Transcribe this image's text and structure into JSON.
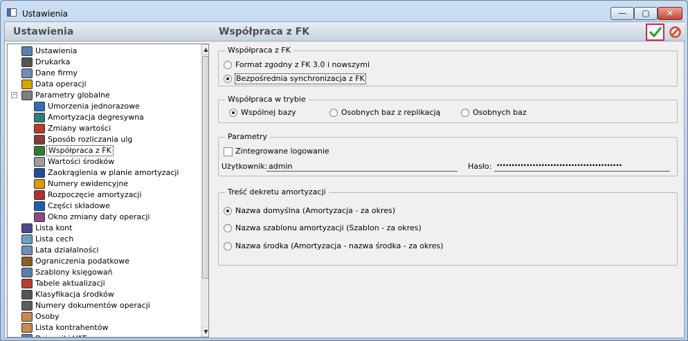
{
  "window": {
    "title": "Ustawienia",
    "min_glyph": "—",
    "max_glyph": "▢",
    "close_glyph": "✕"
  },
  "left": {
    "header": "Ustawienia",
    "tree": [
      {
        "label": "Ustawienia",
        "icon": "tools-icon"
      },
      {
        "label": "Drukarka",
        "icon": "printer-icon"
      },
      {
        "label": "Dane firmy",
        "icon": "company-icon"
      },
      {
        "label": "Data operacji",
        "icon": "calendar-icon"
      },
      {
        "label": "Parametry globalne",
        "icon": "parameters-icon"
      },
      {
        "label": "Umorzenia jednorazowe",
        "icon": "depreciation-icon"
      },
      {
        "label": "Amortyzacja degresywna",
        "icon": "degressive-icon"
      },
      {
        "label": "Zmiany wartości",
        "icon": "value-change-icon"
      },
      {
        "label": "Sposób rozliczania ulg",
        "icon": "relief-icon"
      },
      {
        "label": "Współpraca z FK",
        "icon": "fk-icon"
      },
      {
        "label": "Wartości środków",
        "icon": "asset-value-icon"
      },
      {
        "label": "Zaokrąglenia w planie amortyzacji",
        "icon": "rounding-icon"
      },
      {
        "label": "Numery ewidencyjne",
        "icon": "numbers-icon"
      },
      {
        "label": "Rozpoczęcie amortyzacji",
        "icon": "start-icon"
      },
      {
        "label": "Części składowe",
        "icon": "components-icon"
      },
      {
        "label": "Okno zmiany daty operacji",
        "icon": "date-window-icon"
      },
      {
        "label": "Lista kont",
        "icon": "accounts-icon"
      },
      {
        "label": "Lista cech",
        "icon": "features-icon"
      },
      {
        "label": "Lata działalności",
        "icon": "years-icon"
      },
      {
        "label": "Ograniczenia podatkowe",
        "icon": "tax-icon"
      },
      {
        "label": "Szablony księgowań",
        "icon": "templates-icon"
      },
      {
        "label": "Tabele aktualizacji",
        "icon": "update-table-icon"
      },
      {
        "label": "Klasyfikacja środków",
        "icon": "classification-icon"
      },
      {
        "label": "Numery dokumentów operacji",
        "icon": "document-icon"
      },
      {
        "label": "Osoby",
        "icon": "person-icon"
      },
      {
        "label": "Lista kontrahentów",
        "icon": "contractors-icon"
      },
      {
        "label": "Dzienniki VAT",
        "icon": "journal-icon"
      }
    ],
    "scroll_up": "▲",
    "scroll_down": "▼"
  },
  "right": {
    "title": "Współpraca z FK",
    "fk_group": {
      "legend": "Współpraca z FK",
      "option1": "Format zgodny z FK 3.0 i nowszymi",
      "option2": "Bezpośrednia synchronizacja z FK"
    },
    "mode_group": {
      "legend": "Współpraca w trybie",
      "option1": "Wspólnej bazy",
      "option2": "Osobnych baz z replikacją",
      "option3": "Osobnych baz"
    },
    "params_group": {
      "legend": "Parametry",
      "integrated_login": "Zintegrowane logowanie",
      "user_label": "Użytkownik:",
      "user_value": "admin",
      "password_label": "Hasło:",
      "password_value": "••••••••••••••••••••••••••••••••••••••••••"
    },
    "decree_group": {
      "legend": "Treść dekretu amortyzacji",
      "option1": "Nazwa domyślna (Amortyzacja - za okres)",
      "option2": "Nazwa szablonu amortyzacji (Szablon - za okres)",
      "option3": "Nazwa środka (Amortyzacja - nazwa środka - za okres)"
    }
  },
  "colors": {
    "ok_highlight": "#d8234f",
    "ok_check": "#2ea02e",
    "cancel": "#d9431e"
  }
}
